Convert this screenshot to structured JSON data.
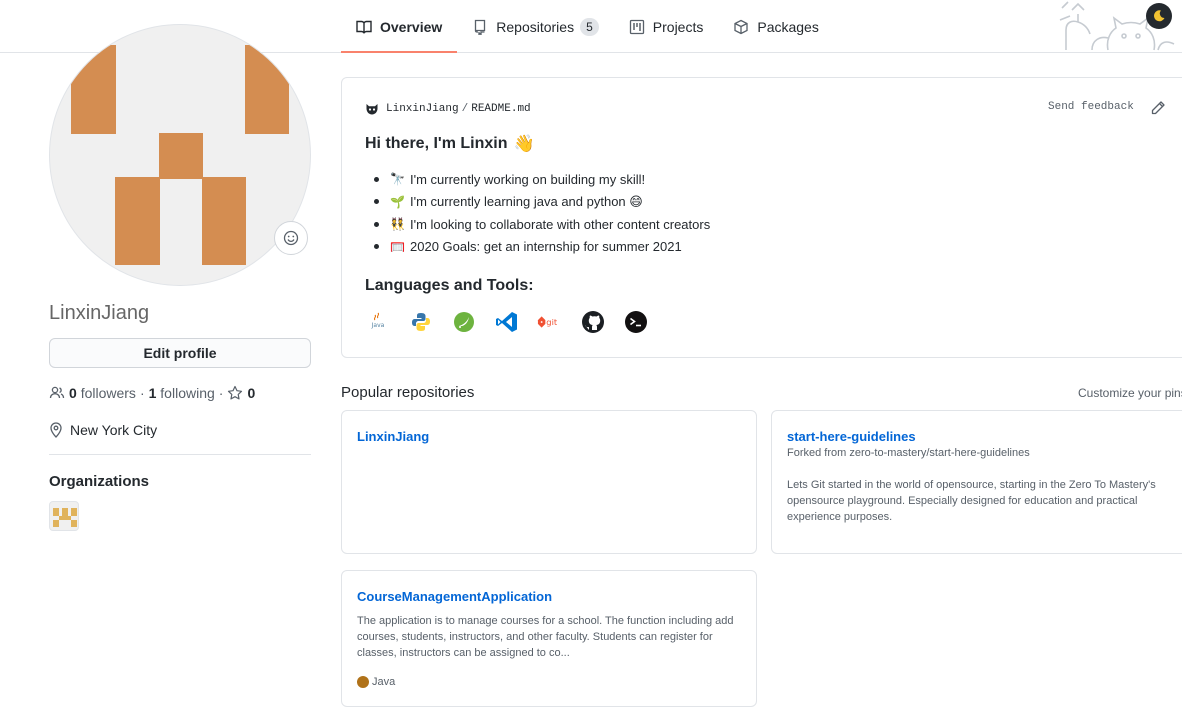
{
  "tabs": [
    {
      "label": "Overview",
      "active": true,
      "icon": "book-icon"
    },
    {
      "label": "Repositories",
      "count": "5",
      "icon": "repo-icon"
    },
    {
      "label": "Projects",
      "icon": "project-icon"
    },
    {
      "label": "Packages",
      "icon": "package-icon"
    }
  ],
  "profile": {
    "username": "LinxinJiang",
    "edit_label": "Edit profile",
    "followers_count": "0",
    "followers_label": "followers",
    "following_count": "1",
    "following_label": "following",
    "stars_count": "0",
    "dot": "·",
    "location": "New York City",
    "organizations_title": "Organizations",
    "avatar_color": "#d48d51"
  },
  "readme": {
    "owner": "LinxinJiang",
    "separator": "/",
    "file": "README.md",
    "send_feedback": "Send feedback",
    "greeting": "Hi there, I'm Linxin",
    "greeting_emoji": "👋",
    "bullets": [
      {
        "emoji": "🔭",
        "text": "I'm currently working on building my skill!"
      },
      {
        "emoji": "🌱",
        "text": "I'm currently learning java and python 😄"
      },
      {
        "emoji": "👯",
        "text": "I'm looking to collaborate with other content creators"
      },
      {
        "emoji": "🥅",
        "text": "2020 Goals: get an internship for summer 2021"
      }
    ],
    "languages_title": "Languages and Tools:",
    "tools": [
      "java-icon",
      "python-icon",
      "spring-icon",
      "vscode-icon",
      "git-icon",
      "github-icon",
      "terminal-icon"
    ],
    "tool_java_text": "Java",
    "tool_git_text": "git"
  },
  "popular": {
    "title": "Popular repositories",
    "customize": "Customize your pins",
    "repos": [
      {
        "name": "LinxinJiang",
        "forked": "",
        "description": "",
        "language": ""
      },
      {
        "name": "start-here-guidelines",
        "forked": "Forked from zero-to-mastery/start-here-guidelines",
        "description": "Lets Git started in the world of opensource, starting in the Zero To Mastery's opensource playground. Especially designed for education and practical experience purposes.",
        "language": ""
      },
      {
        "name": "CourseManagementApplication",
        "forked": "",
        "description": "The application is to manage courses for a school. The function including add courses, students, instructors, and other faculty. Students can register for classes, instructors can be assigned to co...",
        "language": "Java",
        "language_color": "#b07219"
      }
    ]
  }
}
